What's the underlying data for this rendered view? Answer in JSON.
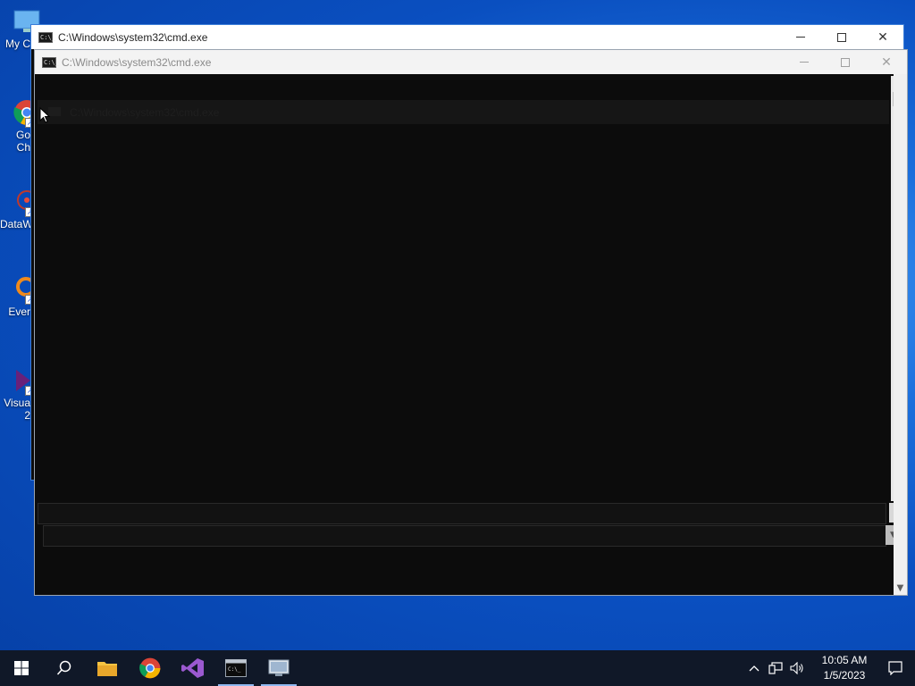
{
  "desktop": {
    "icons": [
      {
        "label_line1": "My C",
        "label_line2": ""
      },
      {
        "label_line1": "Go",
        "label_line2": "Ch"
      },
      {
        "label_line1": "DataW",
        "label_line2": ""
      },
      {
        "label_line1": "Ever",
        "label_line2": ""
      },
      {
        "label_line1": "Visua",
        "label_line2": "2"
      }
    ]
  },
  "window_back": {
    "title": "C:\\Windows\\system32\\cmd.exe",
    "icon_text": "C:\\_",
    "minimize_glyph": "—",
    "close_glyph": "✕"
  },
  "window_front": {
    "title": "C:\\Windows\\system32\\cmd.exe",
    "icon_text": "C:\\_",
    "minimize_glyph": "—",
    "close_glyph": "✕",
    "ghost_title": "C:\\Windows\\system32\\cmd.exe"
  },
  "scrollbar": {
    "up_glyph": "▲",
    "down_glyph": "▼",
    "chevron_up": "⌃",
    "chevron_down": "⌄"
  },
  "taskbar": {
    "items": [
      "start-icon",
      "search-icon",
      "file-explorer-icon",
      "chrome-icon",
      "visual-studio-icon",
      "cmd-icon",
      "remote-desktop-icon"
    ],
    "tray_chevron": "^",
    "volume_glyph": "🔈",
    "time": "10:05 AM",
    "date": "1/5/2023"
  },
  "colors": {
    "wallpaper": "#0a4fc0",
    "console_bg": "#0c0c0c",
    "taskbar_bg": "#101828",
    "vs_purple": "#68217a"
  }
}
